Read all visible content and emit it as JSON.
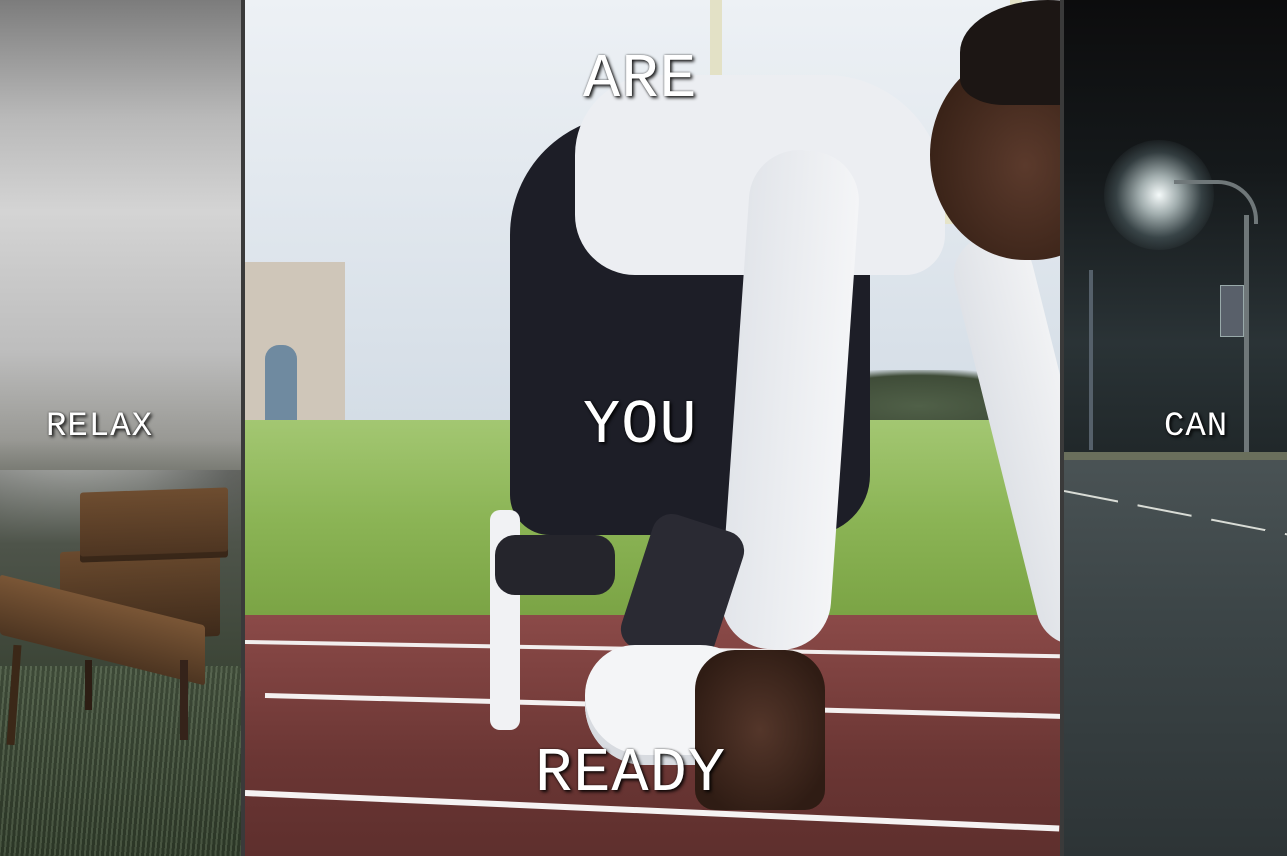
{
  "panels": {
    "left": {
      "word": "RELAX",
      "image": "misty-field-with-wooden-bench"
    },
    "center": {
      "words": [
        "ARE",
        "YOU",
        "READY"
      ],
      "image": "sprinter-in-starting-position-on-track"
    },
    "right": {
      "word": "CAN",
      "image": "empty-road-at-night-with-streetlight"
    }
  },
  "colors": {
    "text": "#ffffff",
    "divider": "#3a3a3a"
  }
}
